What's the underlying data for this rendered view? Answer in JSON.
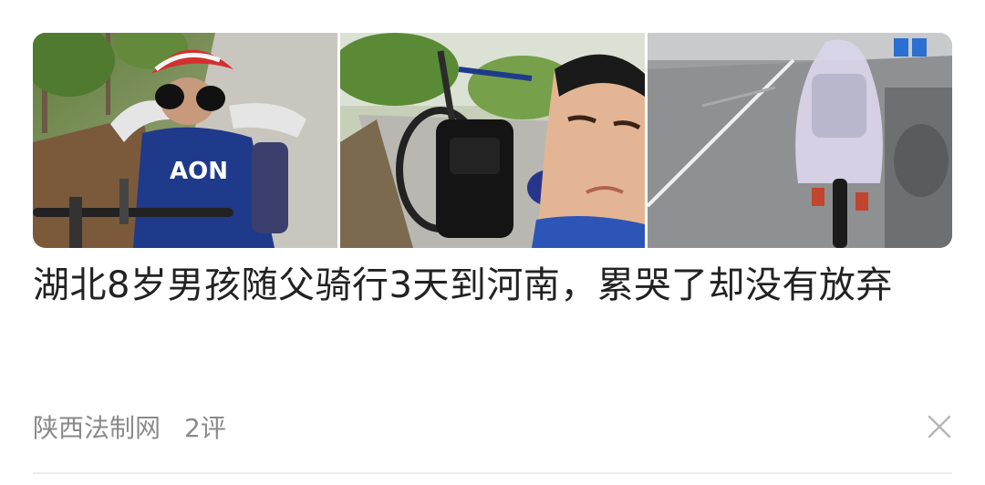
{
  "article": {
    "headline": "湖北8岁男孩随父骑行3天到河南，累哭了却没有放弃",
    "source": "陕西法制网",
    "comments": "2评"
  },
  "thumbnails": [
    {
      "icon": "photo-boy-crying-with-bike",
      "jersey_text": "AON"
    },
    {
      "icon": "photo-boy-face-with-bicycle"
    },
    {
      "icon": "photo-rider-raincoat-wet-road"
    }
  ],
  "icons": {
    "close": "close-icon"
  },
  "colors": {
    "text_primary": "#222222",
    "text_secondary": "#8a8a8a",
    "divider": "#ececec"
  }
}
